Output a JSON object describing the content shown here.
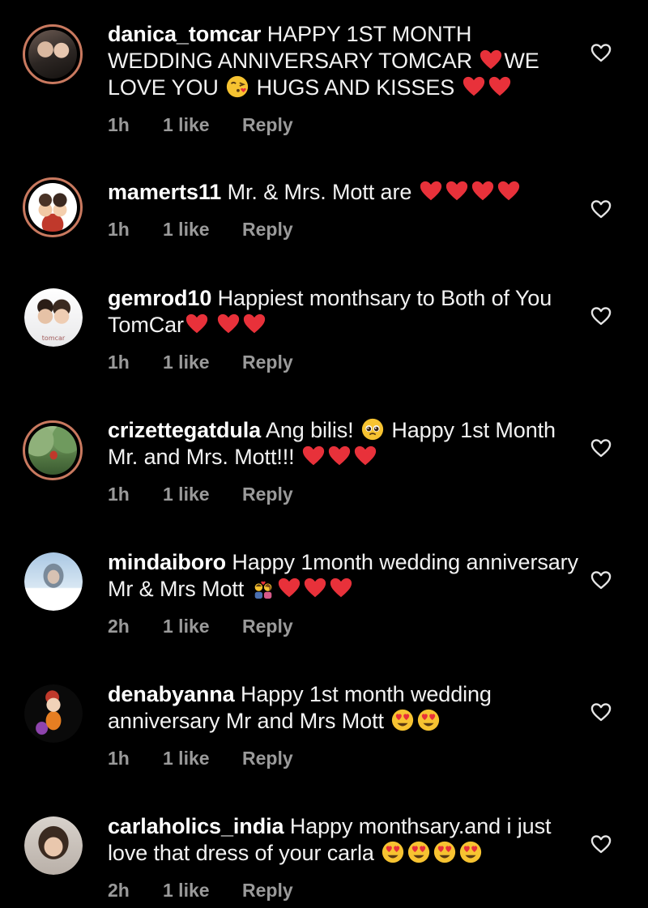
{
  "colors": {
    "background": "#000000",
    "text": "#f2f2f2",
    "meta": "#9a9a9a",
    "heart": "#e8313a",
    "story_ring": "#c9795f"
  },
  "comments": [
    {
      "username": "danica_tomcar",
      "text": "HAPPY 1ST MONTH WEDDING ANNIVERSARY TOMCAR [red-heart-emoji]WE LOVE YOU [face-blowing-kiss-emoji] HUGS AND KISSES [red-heart-emoji][red-heart-emoji]",
      "parts": [
        {
          "t": "HAPPY 1ST MONTH WEDDING ANNIVERSARY TOMCAR "
        },
        {
          "e": "heart"
        },
        {
          "t": "WE LOVE YOU "
        },
        {
          "e": "kiss"
        },
        {
          "t": " HUGS AND KISSES "
        },
        {
          "e": "heart"
        },
        {
          "e": "heart"
        }
      ],
      "time": "1h",
      "likes": "1 like",
      "reply": "Reply",
      "avatar": "photo-avatar",
      "ring": true
    },
    {
      "username": "mamerts11",
      "parts": [
        {
          "t": "Mr. & Mrs. Mott are "
        },
        {
          "e": "heart"
        },
        {
          "e": "heart"
        },
        {
          "e": "heart"
        },
        {
          "e": "heart"
        }
      ],
      "time": "1h",
      "likes": "1 like",
      "reply": "Reply",
      "avatar": "cartoon-avatar",
      "ring": true
    },
    {
      "username": "gemrod10",
      "parts": [
        {
          "t": "Happiest monthsary to Both of You TomCar"
        },
        {
          "e": "heart"
        },
        {
          "t": " "
        },
        {
          "e": "heart"
        },
        {
          "e": "heart"
        }
      ],
      "time": "1h",
      "likes": "1 like",
      "reply": "Reply",
      "avatar": "couple-avatar",
      "avatar_caption": "tomcar",
      "ring": false
    },
    {
      "username": "crizettegatdula",
      "parts": [
        {
          "t": "Ang bilis! "
        },
        {
          "e": "pleading"
        },
        {
          "t": " Happy 1st Month Mr. and Mrs. Mott!!! "
        },
        {
          "e": "heart"
        },
        {
          "e": "heart"
        },
        {
          "e": "heart"
        }
      ],
      "time": "1h",
      "likes": "1 like",
      "reply": "Reply",
      "avatar": "garden-avatar",
      "ring": true
    },
    {
      "username": "mindaiboro",
      "parts": [
        {
          "t": "Happy 1month wedding anniversary Mr & Mrs Mott "
        },
        {
          "e": "couple"
        },
        {
          "e": "heart"
        },
        {
          "e": "heart"
        },
        {
          "e": "heart"
        }
      ],
      "time": "2h",
      "likes": "1 like",
      "reply": "Reply",
      "avatar": "portrait-avatar",
      "ring": false
    },
    {
      "username": "denabyanna",
      "parts": [
        {
          "t": "Happy 1st month wedding anniversary Mr and Mrs Mott "
        },
        {
          "e": "hearteyes"
        },
        {
          "e": "hearteyes"
        }
      ],
      "time": "1h",
      "likes": "1 like",
      "reply": "Reply",
      "avatar": "illustration-avatar",
      "ring": false
    },
    {
      "username": "carlaholics_india",
      "parts": [
        {
          "t": "Happy monthsary.and i just love that dress of your carla "
        },
        {
          "e": "hearteyes"
        },
        {
          "e": "hearteyes"
        },
        {
          "e": "hearteyes"
        },
        {
          "e": "hearteyes"
        }
      ],
      "time": "2h",
      "likes": "1 like",
      "reply": "Reply",
      "avatar": "woman-avatar",
      "ring": false
    }
  ]
}
